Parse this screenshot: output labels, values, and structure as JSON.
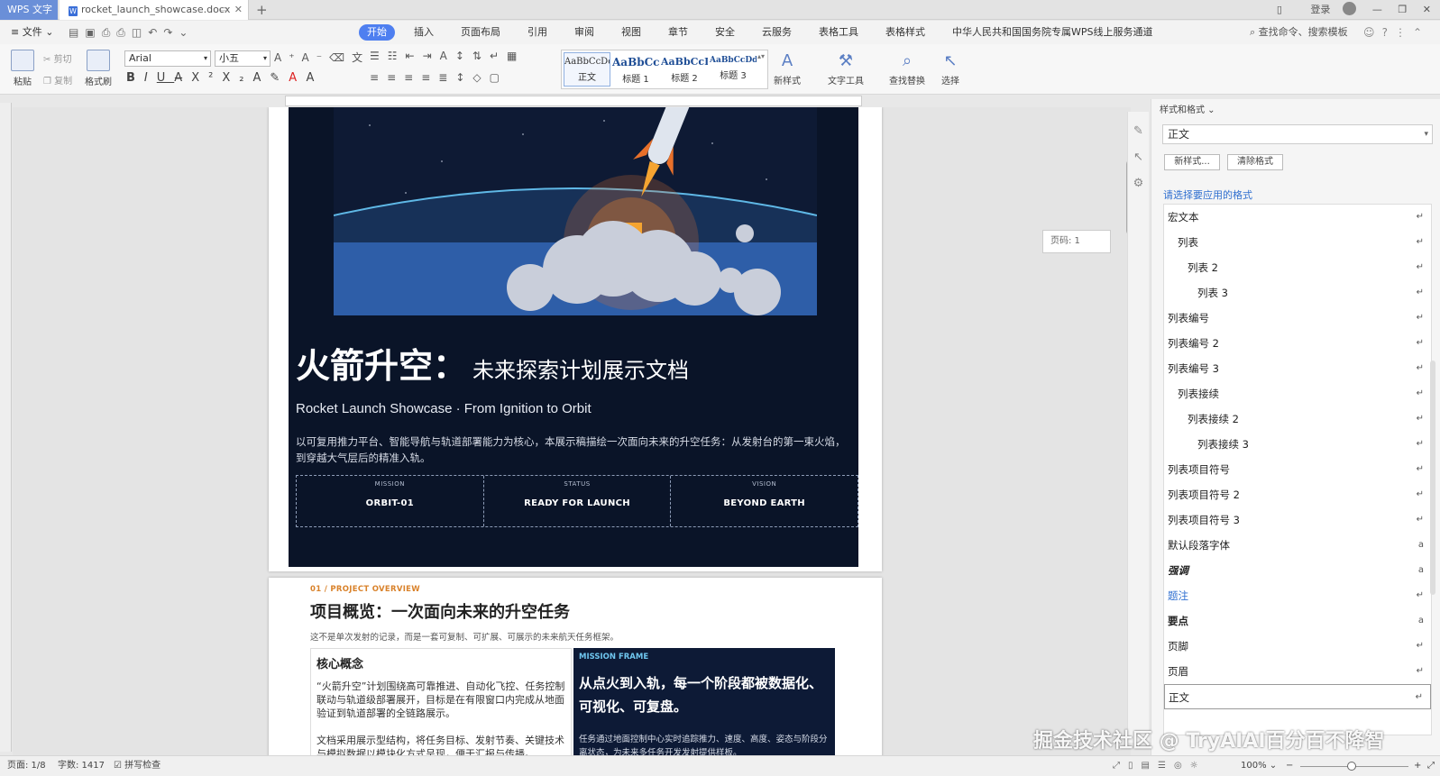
{
  "titlebar": {
    "app_name": "WPS 文字",
    "doc_tab": "rocket_launch_showcase.docx",
    "login": "登录"
  },
  "menubar": {
    "file": "≡ 文件 ⌄",
    "tabs": [
      "开始",
      "插入",
      "页面布局",
      "引用",
      "审阅",
      "视图",
      "章节",
      "安全",
      "云服务",
      "表格工具",
      "表格样式",
      "中华人民共和国国务院专属WPS线上服务通道"
    ],
    "active_tab": "开始",
    "search": "查找命令、搜索模板"
  },
  "ribbon": {
    "paste": "粘贴",
    "cut": "剪切",
    "copy": "复制",
    "format_painter": "格式刷",
    "font_name": "Arial",
    "font_size": "小五",
    "styles": [
      {
        "preview": "AaBbCcDd",
        "name": "正文"
      },
      {
        "preview": "AaBbCc",
        "name": "标题 1"
      },
      {
        "preview": "AaBbCcI",
        "name": "标题 2"
      },
      {
        "preview": "AaBbCcDd",
        "name": "标题 3"
      }
    ],
    "new_style": "新样式",
    "text_tools": "文字工具",
    "find_replace": "查找替换",
    "select": "选择"
  },
  "document": {
    "hero_title": "火箭升空",
    "hero_colon": "：",
    "hero_subtitle": "未来探索计划展示文档",
    "hero_en": "Rocket Launch Showcase · From Ignition to Orbit",
    "hero_desc": "以可复用推力平台、智能导航与轨道部署能力为核心，本展示稿描绘一次面向未来的升空任务：从发射台的第一束火焰，到穿越大气层后的精准入轨。",
    "info": [
      {
        "label": "MISSION",
        "value": "ORBIT-01"
      },
      {
        "label": "STATUS",
        "value": "READY FOR LAUNCH"
      },
      {
        "label": "VISION",
        "value": "BEYOND EARTH"
      }
    ],
    "section_kicker": "01 / PROJECT OVERVIEW",
    "section_title": "项目概览：一次面向未来的升空任务",
    "section_lead": "这不是单次发射的记录，而是一套可复制、可扩展、可展示的未来航天任务框架。",
    "core_title": "核心概念",
    "core_p1": "“火箭升空”计划围绕高可靠推进、自动化飞控、任务控制联动与轨道级部署展开，目标是在有限窗口内完成从地面验证到轨道部署的全链路展示。",
    "core_p2": "文档采用展示型结构，将任务目标、发射节奏、关键技术与模拟数据以模块化方式呈现，便于汇报与传播。",
    "frame_kicker": "MISSION FRAME",
    "frame_title": "从点火到入轨，每一个阶段都被数据化、可视化、可复盘。",
    "frame_desc": "任务通过地面控制中心实时追踪推力、速度、高度、姿态与阶段分离状态，为未来多任务开发发射提供样板。",
    "page_tip": "页码: 1"
  },
  "style_pane": {
    "title": "样式和格式 ⌄",
    "current": "正文",
    "new_style_btn": "新样式...",
    "clear_btn": "清除格式",
    "hint": "请选择要应用的格式",
    "items": [
      {
        "label": "宏文本",
        "indent": 0,
        "mark": "↵"
      },
      {
        "label": "列表",
        "indent": 1,
        "mark": "↵"
      },
      {
        "label": "列表 2",
        "indent": 2,
        "mark": "↵"
      },
      {
        "label": "列表 3",
        "indent": 3,
        "mark": "↵"
      },
      {
        "label": "列表编号",
        "indent": 0,
        "mark": "↵"
      },
      {
        "label": "列表编号 2",
        "indent": 0,
        "mark": "↵"
      },
      {
        "label": "列表编号 3",
        "indent": 0,
        "mark": "↵"
      },
      {
        "label": "列表接续",
        "indent": 1,
        "mark": "↵"
      },
      {
        "label": "列表接续 2",
        "indent": 2,
        "mark": "↵"
      },
      {
        "label": "列表接续 3",
        "indent": 3,
        "mark": "↵"
      },
      {
        "label": "列表项目符号",
        "indent": 0,
        "mark": "↵"
      },
      {
        "label": "列表项目符号 2",
        "indent": 0,
        "mark": "↵"
      },
      {
        "label": "列表项目符号 3",
        "indent": 0,
        "mark": "↵"
      },
      {
        "label": "默认段落字体",
        "indent": 0,
        "mark": "a"
      },
      {
        "label": "强调",
        "indent": 0,
        "mark": "a",
        "style": "italic-bold"
      },
      {
        "label": "题注",
        "indent": 0,
        "mark": "↵",
        "style": "blue"
      },
      {
        "label": "要点",
        "indent": 0,
        "mark": "a",
        "style": "bold"
      },
      {
        "label": "页脚",
        "indent": 0,
        "mark": "↵"
      },
      {
        "label": "页眉",
        "indent": 0,
        "mark": "↵"
      },
      {
        "label": "正文",
        "indent": 0,
        "mark": "↵",
        "selected": true
      }
    ]
  },
  "statusbar": {
    "page": "页面: 1/8",
    "words": "字数: 1417",
    "spell": "拼写检查",
    "zoom": "100% ⌄"
  },
  "watermark": "掘金技术社区 @ TryAIAI百分百不降智",
  "colors": {
    "accent": "#4e7ff0",
    "hero_bg": "#0a1428",
    "kicker": "#d9822b",
    "frame_kicker": "#6fc6ef"
  }
}
